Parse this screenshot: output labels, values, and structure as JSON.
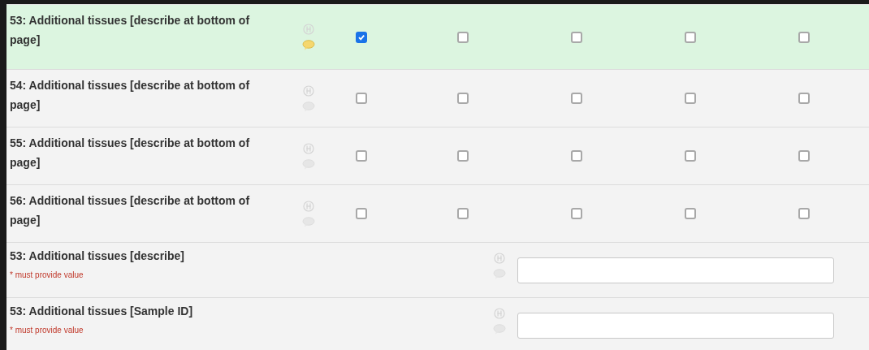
{
  "matrix_rows": [
    {
      "label": "53: Additional tissues [describe at bottom of page]",
      "highlighted": true,
      "has_comment": true,
      "options": [
        {
          "checked": true
        },
        {
          "checked": false
        },
        {
          "checked": false
        },
        {
          "checked": false
        },
        {
          "checked": false
        }
      ]
    },
    {
      "label": "54: Additional tissues [describe at bottom of page]",
      "highlighted": false,
      "has_comment": false,
      "options": [
        {
          "checked": false
        },
        {
          "checked": false
        },
        {
          "checked": false
        },
        {
          "checked": false
        },
        {
          "checked": false
        }
      ]
    },
    {
      "label": "55: Additional tissues [describe at bottom of page]",
      "highlighted": false,
      "has_comment": false,
      "options": [
        {
          "checked": false
        },
        {
          "checked": false
        },
        {
          "checked": false
        },
        {
          "checked": false
        },
        {
          "checked": false
        }
      ]
    },
    {
      "label": "56: Additional tissues [describe at bottom of page]",
      "highlighted": false,
      "has_comment": false,
      "options": [
        {
          "checked": false
        },
        {
          "checked": false
        },
        {
          "checked": false
        },
        {
          "checked": false
        },
        {
          "checked": false
        }
      ]
    }
  ],
  "text_rows": [
    {
      "label": "53: Additional tissues [describe]",
      "note": "* must provide value",
      "has_comment": false
    },
    {
      "label": "53: Additional tissues [Sample ID]",
      "note": "* must provide value",
      "has_comment": false
    }
  ]
}
